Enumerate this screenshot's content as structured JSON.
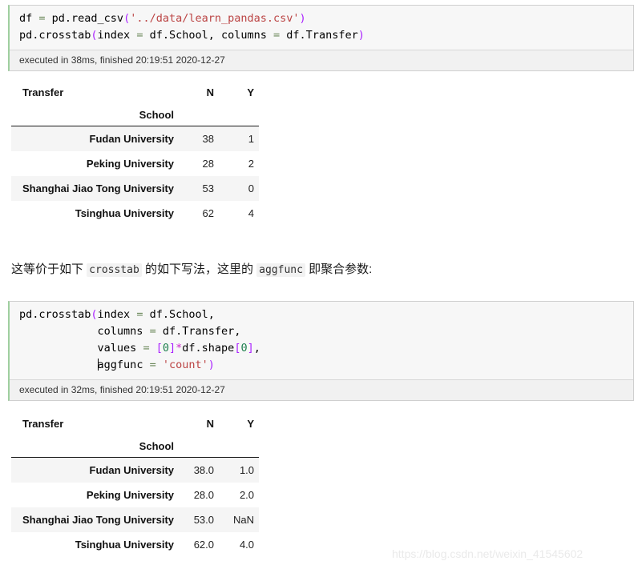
{
  "cells": [
    {
      "id": "cell-1",
      "code_lines": [
        [
          {
            "t": "df ",
            "c": "name"
          },
          {
            "t": "=",
            "c": "op"
          },
          {
            "t": " pd.read_csv",
            "c": "name"
          },
          {
            "t": "(",
            "c": "paren"
          },
          {
            "t": "'../data/learn_pandas.csv'",
            "c": "str"
          },
          {
            "t": ")",
            "c": "paren"
          }
        ],
        [
          {
            "t": "pd.crosstab",
            "c": "name"
          },
          {
            "t": "(",
            "c": "paren"
          },
          {
            "t": "index ",
            "c": "name"
          },
          {
            "t": "=",
            "c": "op"
          },
          {
            "t": " df.School, columns ",
            "c": "name"
          },
          {
            "t": "=",
            "c": "op"
          },
          {
            "t": " df.Transfer",
            "c": "name"
          },
          {
            "t": ")",
            "c": "paren"
          }
        ]
      ],
      "status": "executed in 38ms, finished 20:19:51 2020-12-27"
    },
    {
      "id": "cell-2",
      "code_lines": [
        [
          {
            "t": "pd.crosstab",
            "c": "name"
          },
          {
            "t": "(",
            "c": "paren"
          },
          {
            "t": "index ",
            "c": "name"
          },
          {
            "t": "=",
            "c": "op"
          },
          {
            "t": " df.School,",
            "c": "name"
          }
        ],
        [
          {
            "t": "            columns ",
            "c": "name"
          },
          {
            "t": "=",
            "c": "op"
          },
          {
            "t": " df.Transfer,",
            "c": "name"
          }
        ],
        [
          {
            "t": "            values ",
            "c": "name"
          },
          {
            "t": "=",
            "c": "op"
          },
          {
            "t": " ",
            "c": "name"
          },
          {
            "t": "[",
            "c": "paren"
          },
          {
            "t": "0",
            "c": "num"
          },
          {
            "t": "]",
            "c": "paren"
          },
          {
            "t": "*",
            "c": "star"
          },
          {
            "t": "df.shape",
            "c": "name"
          },
          {
            "t": "[",
            "c": "paren"
          },
          {
            "t": "0",
            "c": "num"
          },
          {
            "t": "]",
            "c": "paren"
          },
          {
            "t": ",",
            "c": "name"
          }
        ],
        [
          {
            "t": "            ",
            "c": "name"
          },
          {
            "t": "",
            "c": "caret"
          },
          {
            "t": "aggfunc ",
            "c": "name"
          },
          {
            "t": "=",
            "c": "op"
          },
          {
            "t": " ",
            "c": "name"
          },
          {
            "t": "'count'",
            "c": "str"
          },
          {
            "t": ")",
            "c": "paren"
          }
        ]
      ],
      "status": "executed in 32ms, finished 20:19:51 2020-12-27"
    }
  ],
  "prose": {
    "part_1": "这等价于如下 ",
    "code_1": "crosstab",
    "part_2": " 的如下写法，这里的 ",
    "code_2": "aggfunc",
    "part_3": " 即聚合参数:"
  },
  "tables": [
    {
      "id": "table-1",
      "columns_name": "Transfer",
      "index_name": "School",
      "columns": [
        "N",
        "Y"
      ],
      "rows": [
        {
          "label": "Fudan University",
          "values": [
            "38",
            "1"
          ]
        },
        {
          "label": "Peking University",
          "values": [
            "28",
            "2"
          ]
        },
        {
          "label": "Shanghai Jiao Tong University",
          "values": [
            "53",
            "0"
          ]
        },
        {
          "label": "Tsinghua University",
          "values": [
            "62",
            "4"
          ]
        }
      ]
    },
    {
      "id": "table-2",
      "columns_name": "Transfer",
      "index_name": "School",
      "columns": [
        "N",
        "Y"
      ],
      "rows": [
        {
          "label": "Fudan University",
          "values": [
            "38.0",
            "1.0"
          ]
        },
        {
          "label": "Peking University",
          "values": [
            "28.0",
            "2.0"
          ]
        },
        {
          "label": "Shanghai Jiao Tong University",
          "values": [
            "53.0",
            "NaN"
          ]
        },
        {
          "label": "Tsinghua University",
          "values": [
            "62.0",
            "4.0"
          ]
        }
      ]
    }
  ],
  "watermark": "https://blog.csdn.net/weixin_41545602",
  "colors": {
    "cell_background": "#f7f7f7",
    "cell_border": "#cfcfcf",
    "cell_accent": "#9fcf9f",
    "status_background": "#f1f1f1",
    "row_stripe": "#f5f5f5",
    "string_token": "#bb4444",
    "operator_token": "#6a8759",
    "paren_token": "#aa22ff",
    "number_token": "#208050",
    "watermark": "#eaeaea"
  }
}
